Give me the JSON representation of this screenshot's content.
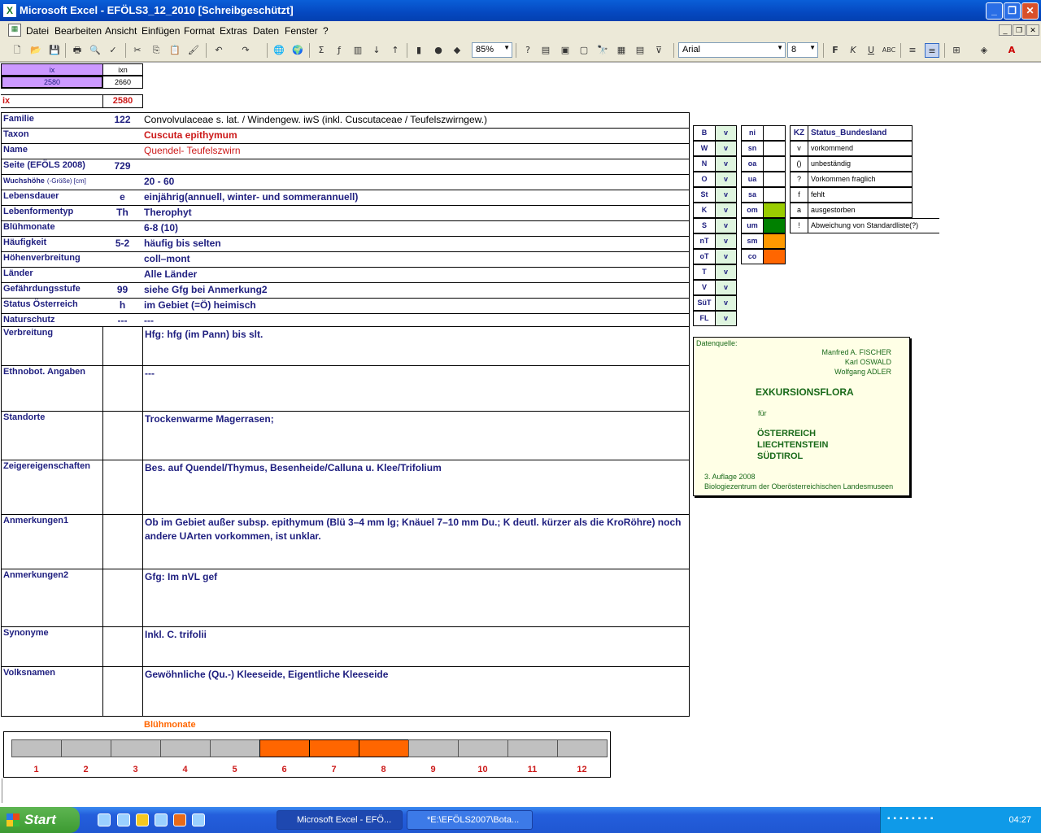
{
  "window": {
    "title": "Microsoft Excel - EFÖLS3_12_2010  [Schreibgeschützt]"
  },
  "menu": [
    "Datei",
    "Bearbeiten",
    "Ansicht",
    "Einfügen",
    "Format",
    "Extras",
    "Daten",
    "Fenster",
    "?"
  ],
  "toolbar": {
    "zoom": "85%",
    "font": "Arial",
    "size": "8"
  },
  "header": {
    "ix_label": "ix",
    "ixn_label": "ixn",
    "ix_value": "2580",
    "ixn_value": "2660",
    "ix2_label": "ix",
    "ix2_value": "2580"
  },
  "rows": [
    {
      "label": "Familie",
      "code": "122",
      "value": "Convolvulaceae s. lat.  /  Windengew. iwS (inkl. Cuscutaceae / Teufelszwirngew.)"
    },
    {
      "label": "Taxon",
      "code": "",
      "value": "Cuscuta epithymum"
    },
    {
      "label": "Name",
      "code": "",
      "value": "Quendel- Teufelszwirn"
    },
    {
      "label": "Seite (EFÖLS 2008)",
      "code": "729",
      "value": ""
    },
    {
      "label": "Wuchshöhe",
      "label_small": "(-Größe) [cm]",
      "code": "",
      "value": " 20 - 60"
    },
    {
      "label": "Lebensdauer",
      "code": "e",
      "value": "einjährig(annuell, winter- und sommerannuell)"
    },
    {
      "label": "Lebenformentyp",
      "code": "Th",
      "value": "Therophyt"
    },
    {
      "label": "Blühmonate",
      "code": "",
      "value": " 6-8 (10)"
    },
    {
      "label": "Häufigkeit",
      "code": "5-2",
      "value": "häufig bis selten"
    },
    {
      "label": "Höhenverbreitung",
      "code": "",
      "value": "coll–mont"
    },
    {
      "label": "Länder",
      "code": "",
      "value": "Alle Länder"
    },
    {
      "label": "Gefährdungsstufe",
      "code": "99",
      "value": "siehe Gfg bei Anmerkung2"
    },
    {
      "label": "Status Österreich",
      "code": "h",
      "value": "im Gebiet (=Ö) heimisch"
    },
    {
      "label": "Naturschutz",
      "code": "---",
      "value": "---"
    }
  ],
  "text_rows": [
    {
      "label": "Verbreitung",
      "value": "Hfg: hfg (im Pann) bis slt."
    },
    {
      "label": "Ethnobot. Angaben",
      "value": "---"
    },
    {
      "label": "Standorte",
      "value": "Trockenwarme Magerrasen;"
    },
    {
      "label": "Zeigereigenschaften",
      "value": "Bes. auf Quendel/Thymus, Besenheide/Calluna u. Klee/Trifolium"
    },
    {
      "label": "Anmerkungen1",
      "value": "Ob im Gebiet außer subsp. epithymum (Blü 3–4 mm lg; Knäuel 7–10 mm Du.; K deutl. kürzer als die KroRöhre) noch andere UArten vorkommen, ist unklar."
    },
    {
      "label": "Anmerkungen2",
      "value": "Gfg: Im nVL gef"
    },
    {
      "label": "Synonyme",
      "value": "Inkl. C. trifolii"
    },
    {
      "label": "Volksnamen",
      "value": "Gewöhnliche (Qu.-) Kleeseide,   Eigentliche Kleeseide"
    }
  ],
  "bundesland": [
    {
      "code": "B",
      "val": "v"
    },
    {
      "code": "W",
      "val": "v"
    },
    {
      "code": "N",
      "val": "v"
    },
    {
      "code": "O",
      "val": "v"
    },
    {
      "code": "St",
      "val": "v"
    },
    {
      "code": "K",
      "val": "v"
    },
    {
      "code": "S",
      "val": "v"
    },
    {
      "code": "nT",
      "val": "v"
    },
    {
      "code": "oT",
      "val": "v"
    },
    {
      "code": "T",
      "val": "v"
    },
    {
      "code": "V",
      "val": "v"
    },
    {
      "code": "SüT",
      "val": "v"
    },
    {
      "code": "FL",
      "val": "v"
    }
  ],
  "hoehen": [
    {
      "code": "ni",
      "color": "#ffffff"
    },
    {
      "code": "sn",
      "color": "#ffffff"
    },
    {
      "code": "oa",
      "color": "#ffffff"
    },
    {
      "code": "ua",
      "color": "#ffffff"
    },
    {
      "code": "sa",
      "color": "#ffffff"
    },
    {
      "code": "om",
      "color": "#99cc00"
    },
    {
      "code": "um",
      "color": "#008000"
    },
    {
      "code": "sm",
      "color": "#ff9900"
    },
    {
      "code": "co",
      "color": "#ff6600"
    }
  ],
  "legend": {
    "kz": "KZ",
    "title": "Status_Bundesland",
    "items": [
      {
        "k": "v",
        "t": "vorkommend"
      },
      {
        "k": "()",
        "t": "unbeständig"
      },
      {
        "k": "?",
        "t": "Vorkommen fraglich"
      },
      {
        "k": "f",
        "t": "fehlt"
      },
      {
        "k": "a",
        "t": "ausgestorben"
      },
      {
        "k": "!",
        "t": "Abweichung von Standardliste(?)"
      }
    ]
  },
  "source": {
    "label": "Datenquelle:",
    "authors": [
      "Manfred A. FISCHER",
      "Karl OSWALD",
      "Wolfgang ADLER"
    ],
    "title": "EXKURSIONSFLORA",
    "fuer": "für",
    "countries": [
      "ÖSTERREICH",
      "LIECHTENSTEIN",
      "SÜDTIROL"
    ],
    "edition": "3. Auflage 2008",
    "publisher": "Biologiezentrum der Oberösterreichischen Landesmuseen"
  },
  "chart_data": {
    "type": "bar",
    "title": "Blühmonate",
    "categories": [
      "1",
      "2",
      "3",
      "4",
      "5",
      "6",
      "7",
      "8",
      "9",
      "10",
      "11",
      "12"
    ],
    "values": [
      0,
      0,
      0,
      0,
      0,
      1,
      1,
      1,
      0,
      0,
      0,
      0
    ],
    "colors": {
      "on": "#ff6600",
      "off": "#c0c0c0"
    }
  },
  "taskbar": {
    "start": "Start",
    "tasks": [
      "Microsoft Excel - EFÖ...",
      "*E:\\EFÖLS2007\\Bota..."
    ],
    "time": "04:27"
  }
}
